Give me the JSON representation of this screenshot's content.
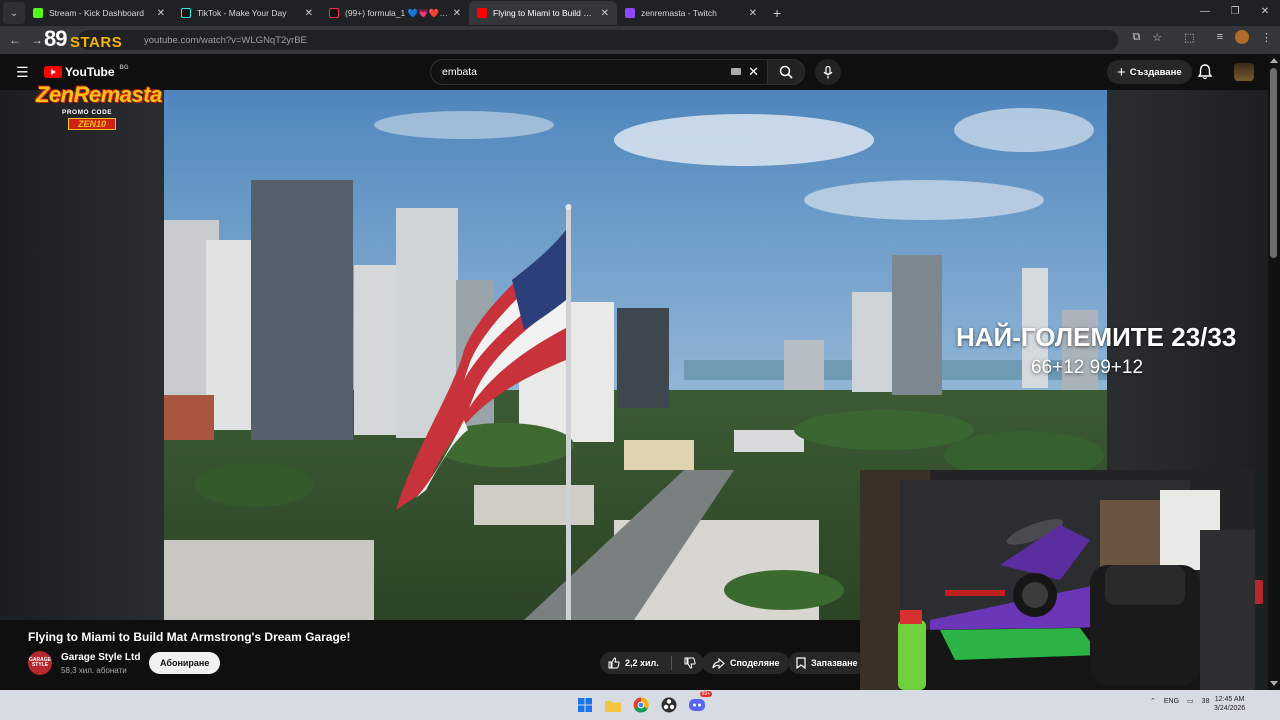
{
  "browser": {
    "tabs": [
      {
        "title": "Stream - Kick Dashboard",
        "favicon_color": "#53fc18",
        "active": false
      },
      {
        "title": "TikTok - Make Your Day",
        "favicon_color": "#111111",
        "active": false
      },
      {
        "title": "(99+) formula_1 💙💗❤️ (@re...",
        "favicon_color": "#111111",
        "active": false
      },
      {
        "title": "Flying to Miami to Build Mat Ar...",
        "favicon_color": "#ff0000",
        "active": true
      },
      {
        "title": "zenremasta - Twitch",
        "favicon_color": "#9146ff",
        "active": false
      }
    ],
    "url": "youtube.com/watch?v=WLGNqT2yrBE"
  },
  "overlay_logo": {
    "number": "89",
    "stars": "STARS",
    "brand": "ZenRemasta",
    "promo_label": "PROMO CODE",
    "promo_code": "ZEN10"
  },
  "youtube": {
    "logo_text": "YouTube",
    "country_code": "BG",
    "search_value": "embata",
    "create_label": "Създаване"
  },
  "stream_overlay": {
    "title": "НАЙ-ГОЛЕМИТЕ 23/33",
    "subtitle": "66+12 99+12"
  },
  "video": {
    "title": "Flying to Miami to Build Mat Armstrong's Dream Garage!",
    "channel_name": "Garage Style Ltd",
    "channel_avatar_text": "GARAGE STYLE",
    "subscribers": "58,3 хил. абонати",
    "subscribe_label": "Абониране",
    "likes": "2,2 хил.",
    "share_label": "Споделяне",
    "save_label": "Запазване"
  },
  "taskbar": {
    "language": "ENG",
    "notifications_badge": "99+",
    "tray_count": "38",
    "time": "12:45 AM",
    "date": "3/24/2026"
  }
}
